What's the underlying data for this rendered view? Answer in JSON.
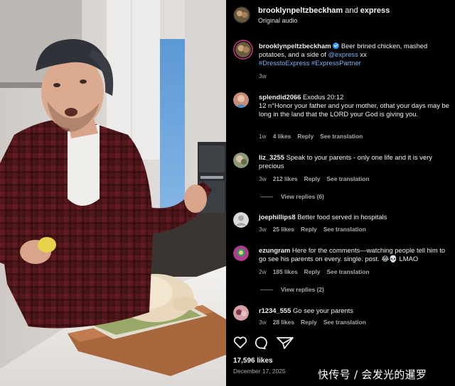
{
  "post": {
    "header_user": "brooklynpeltzbeckham",
    "header_and": "and",
    "header_collab": "express",
    "audio": "Original audio",
    "caption_user": "brooklynpeltzbeckham",
    "caption_pre": "Beer brined chicken, mashed potatoes, and a side of ",
    "caption_mention": "@express",
    "caption_post": " xx",
    "caption_tags": "#DresstoExpress #ExpressPartner",
    "caption_time": "3w"
  },
  "comments": [
    {
      "user": "splendid2066",
      "text": "Exodus 20:12",
      "text2": "12 n°Honor your father and your mother, othat your days may be long in the land that the LORD your God is giving you.",
      "time": "1w",
      "likes": "4 likes",
      "reply": "Reply",
      "translate": "See translation"
    },
    {
      "user": "liz_3255",
      "text": "Speak to your parents - only one life and it is very precious",
      "time": "3w",
      "likes": "212 likes",
      "reply": "Reply",
      "translate": "See translation",
      "view_replies": "View replies (6)"
    },
    {
      "user": "joephillips8",
      "text": "Better food served in hospitals",
      "time": "3w",
      "likes": "25 likes",
      "reply": "Reply",
      "translate": "See translation"
    },
    {
      "user": "ezungram",
      "text": "Here for the comments—watching people tell him to go see his parents on every. single. post. 😂💀 LMAO",
      "time": "2w",
      "likes": "185 likes",
      "reply": "Reply",
      "translate": "See translation",
      "view_replies": "View replies (2)"
    },
    {
      "user": "r1234_555",
      "text": "Go see your parents",
      "time": "3w",
      "likes": "28 likes",
      "reply": "Reply",
      "translate": "See translation"
    }
  ],
  "footer": {
    "likes": "17,596 likes",
    "date": "December 17, 2025"
  },
  "icons": [
    "heart-icon",
    "comment-icon",
    "share-icon",
    "verified-badge-icon"
  ],
  "colors": {
    "panel_bg": "#000000",
    "link": "#7db2f6",
    "verified": "#3897f0",
    "meta": "#a8a8a8"
  },
  "watermark": "快传号 / 会发光的暹罗"
}
